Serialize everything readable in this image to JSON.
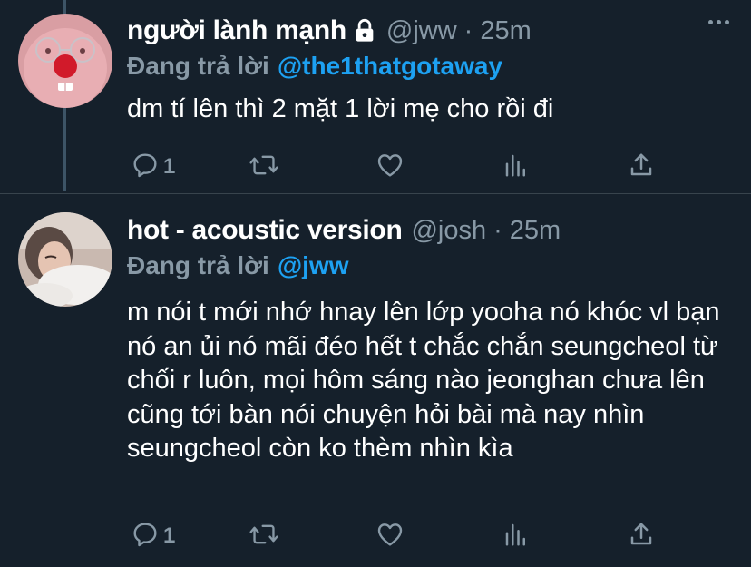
{
  "tweets": [
    {
      "display_name": "người lành mạnh",
      "handle": "@jww",
      "separator": "·",
      "time": "25m",
      "reply_prefix": "Đang trả lời",
      "reply_to": "@the1thatgotaway",
      "text": "dm tí lên thì 2 mặt 1 lời mẹ cho rồi đi",
      "reply_count": "1",
      "protected": true
    },
    {
      "display_name": "hot - acoustic version",
      "handle": "@josh",
      "separator": "·",
      "time": "25m",
      "reply_prefix": "Đang trả lời",
      "reply_to": "@jww",
      "text": "m nói t mới nhớ hnay lên lớp yooha nó khóc vl bạn nó an ủi nó mãi đéo hết t chắc chắn seungcheol từ chối r luôn, mọi hôm sáng nào jeonghan chưa lên cũng tới bàn nói chuyện hỏi bài mà nay nhìn seungcheol còn ko thèm nhìn kìa",
      "reply_count": "1",
      "protected": false
    }
  ],
  "icons": {
    "reply": "reply-icon",
    "retweet": "retweet-icon",
    "like": "heart-icon",
    "stats": "analytics-icon",
    "share": "share-icon",
    "more": "more-icon",
    "lock": "lock-icon"
  },
  "colors": {
    "background": "#15202b",
    "text": "#ffffff",
    "secondary": "#8899a6",
    "accent": "#1da1f2",
    "divider": "#38444d"
  }
}
